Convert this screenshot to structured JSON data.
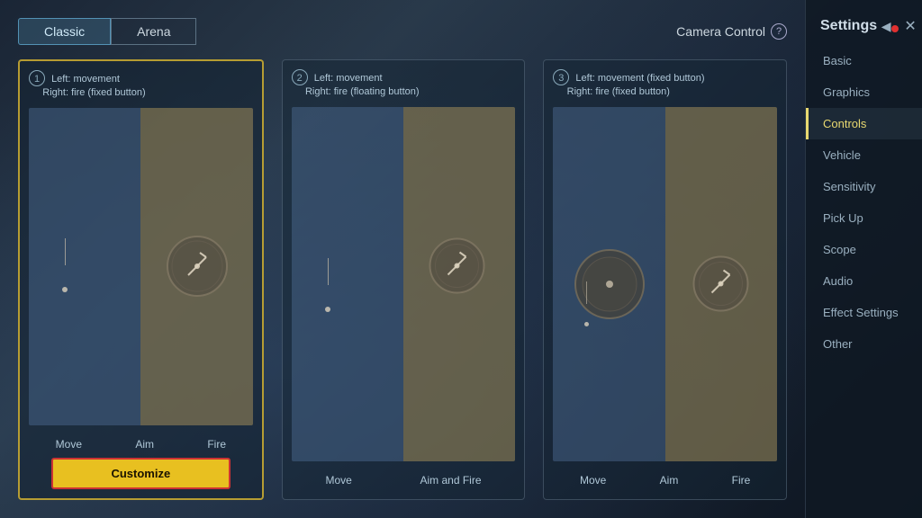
{
  "tabs": {
    "classic_label": "Classic",
    "arena_label": "Arena",
    "active": "classic"
  },
  "camera_control": {
    "label": "Camera Control"
  },
  "options": [
    {
      "id": 1,
      "selected": true,
      "number": "1",
      "line1": "Left: movement",
      "line2": "Right: fire (fixed button)",
      "footer": [
        "Move",
        "Aim",
        "Fire"
      ],
      "has_customize": true,
      "customize_label": "Customize"
    },
    {
      "id": 2,
      "selected": false,
      "number": "2",
      "line1": "Left: movement",
      "line2": "Right: fire (floating button)",
      "footer": [
        "Move",
        "Aim and Fire"
      ],
      "has_customize": false
    },
    {
      "id": 3,
      "selected": false,
      "number": "3",
      "line1": "Left: movement (fixed button)",
      "line2": "Right: fire (fixed button)",
      "footer": [
        "Move",
        "Aim",
        "Fire"
      ],
      "has_customize": false
    }
  ],
  "sidebar": {
    "title": "Settings",
    "items": [
      {
        "id": "basic",
        "label": "Basic",
        "active": false
      },
      {
        "id": "graphics",
        "label": "Graphics",
        "active": false
      },
      {
        "id": "controls",
        "label": "Controls",
        "active": true
      },
      {
        "id": "vehicle",
        "label": "Vehicle",
        "active": false
      },
      {
        "id": "sensitivity",
        "label": "Sensitivity",
        "active": false
      },
      {
        "id": "pickup",
        "label": "Pick Up",
        "active": false
      },
      {
        "id": "scope",
        "label": "Scope",
        "active": false
      },
      {
        "id": "audio",
        "label": "Audio",
        "active": false
      },
      {
        "id": "effects",
        "label": "Effect Settings",
        "active": false
      },
      {
        "id": "other",
        "label": "Other",
        "active": false
      }
    ]
  }
}
